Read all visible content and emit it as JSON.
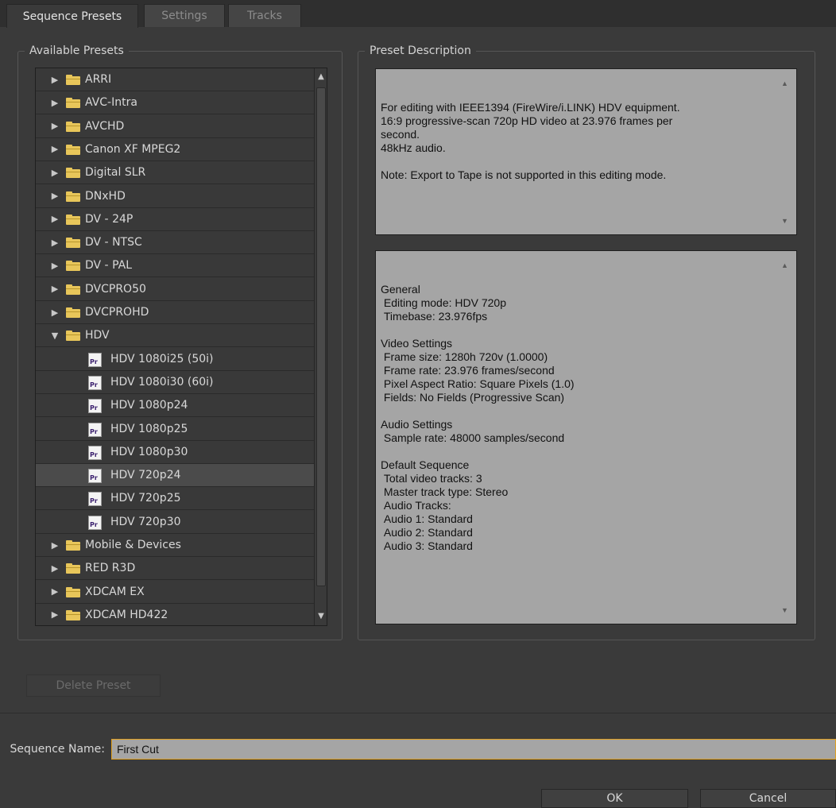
{
  "tabs": [
    {
      "label": "Sequence Presets",
      "active": true
    },
    {
      "label": "Settings",
      "active": false
    },
    {
      "label": "Tracks",
      "active": false
    }
  ],
  "available_presets": {
    "title": "Available Presets",
    "items": [
      {
        "label": "ARRI",
        "type": "folder",
        "expanded": false
      },
      {
        "label": "AVC-Intra",
        "type": "folder",
        "expanded": false
      },
      {
        "label": "AVCHD",
        "type": "folder",
        "expanded": false
      },
      {
        "label": "Canon XF MPEG2",
        "type": "folder",
        "expanded": false
      },
      {
        "label": "Digital SLR",
        "type": "folder",
        "expanded": false
      },
      {
        "label": "DNxHD",
        "type": "folder",
        "expanded": false
      },
      {
        "label": "DV - 24P",
        "type": "folder",
        "expanded": false
      },
      {
        "label": "DV - NTSC",
        "type": "folder",
        "expanded": false
      },
      {
        "label": "DV - PAL",
        "type": "folder",
        "expanded": false
      },
      {
        "label": "DVCPRO50",
        "type": "folder",
        "expanded": false
      },
      {
        "label": "DVCPROHD",
        "type": "folder",
        "expanded": false
      },
      {
        "label": "HDV",
        "type": "folder",
        "expanded": true
      },
      {
        "label": "HDV 1080i25 (50i)",
        "type": "preset"
      },
      {
        "label": "HDV 1080i30 (60i)",
        "type": "preset"
      },
      {
        "label": "HDV 1080p24",
        "type": "preset"
      },
      {
        "label": "HDV 1080p25",
        "type": "preset"
      },
      {
        "label": "HDV 1080p30",
        "type": "preset"
      },
      {
        "label": "HDV 720p24",
        "type": "preset",
        "selected": true
      },
      {
        "label": "HDV 720p25",
        "type": "preset"
      },
      {
        "label": "HDV 720p30",
        "type": "preset"
      },
      {
        "label": "Mobile & Devices",
        "type": "folder",
        "expanded": false
      },
      {
        "label": "RED R3D",
        "type": "folder",
        "expanded": false
      },
      {
        "label": "XDCAM EX",
        "type": "folder",
        "expanded": false
      },
      {
        "label": "XDCAM HD422",
        "type": "folder",
        "expanded": false
      }
    ]
  },
  "preset_description": {
    "title": "Preset Description",
    "description": "For editing with IEEE1394 (FireWire/i.LINK) HDV equipment.\n16:9 progressive-scan 720p HD video at 23.976 frames per\nsecond.\n48kHz audio.\n\nNote: Export to Tape is not supported in this editing mode.",
    "details": "General\n Editing mode: HDV 720p\n Timebase: 23.976fps\n\nVideo Settings\n Frame size: 1280h 720v (1.0000)\n Frame rate: 23.976 frames/second\n Pixel Aspect Ratio: Square Pixels (1.0)\n Fields: No Fields (Progressive Scan)\n\nAudio Settings\n Sample rate: 48000 samples/second\n\nDefault Sequence\n Total video tracks: 3\n Master track type: Stereo\n Audio Tracks:\n Audio 1: Standard\n Audio 2: Standard\n Audio 3: Standard"
  },
  "delete_preset_label": "Delete Preset",
  "sequence_name": {
    "label": "Sequence Name:",
    "value": "First Cut"
  },
  "ok_label": "OK",
  "cancel_label": "Cancel",
  "colors": {
    "folder": "#e8c65a",
    "focus_border": "#e0a020",
    "pane_bg": "#a5a5a5"
  },
  "icons": {
    "folder": "folder-icon",
    "preset": "premiere-preset-icon",
    "expand": "triangle-right-icon",
    "collapse": "triangle-down-icon"
  }
}
